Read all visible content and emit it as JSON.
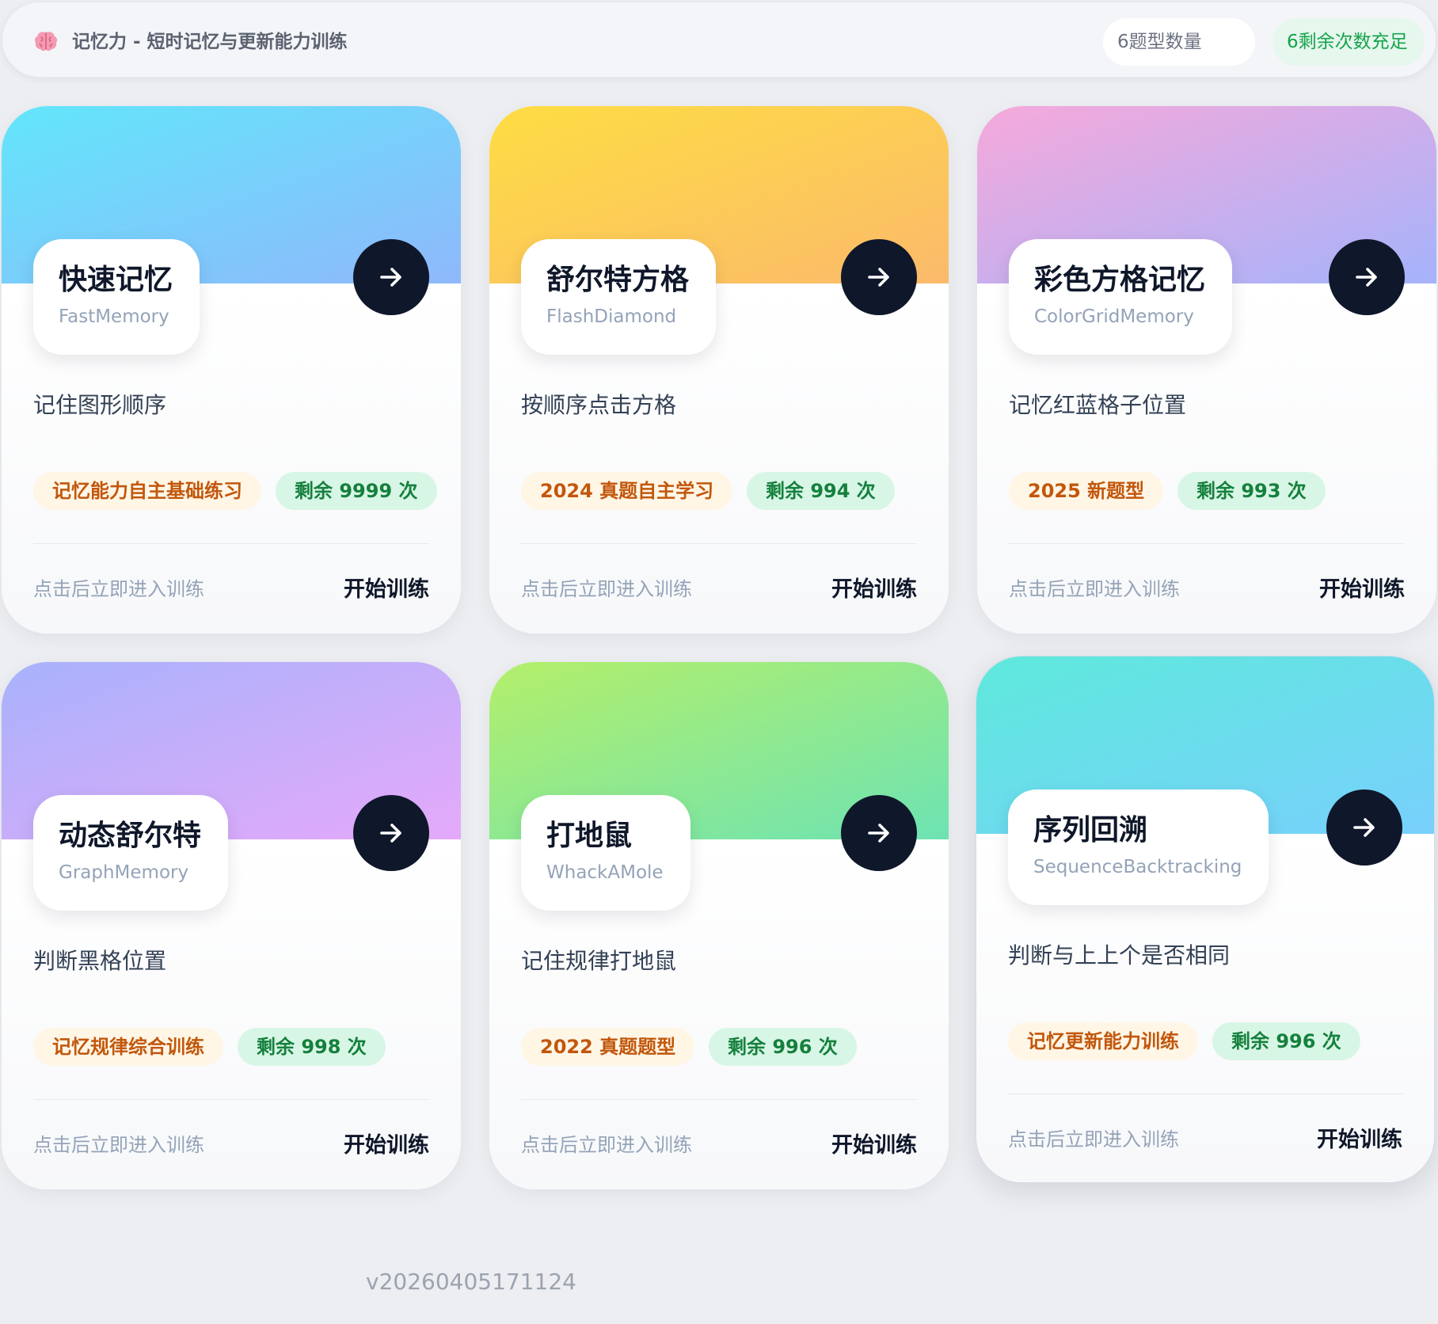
{
  "header": {
    "logo_icon": "brain-icon",
    "title": "记忆力 - 短时记忆与更新能力训练",
    "count_pill": "6题型数量",
    "remaining_pill": "6剩余次数充足"
  },
  "cards": [
    {
      "name": "快速记忆",
      "en": "FastMemory",
      "desc": "记住图形顺序",
      "tag": "记忆能力自主基础练习",
      "remaining": "剩余 9999 次",
      "hint": "点击后立即进入训练",
      "start": "开始训练",
      "gradient": [
        "#62e6fb",
        "#8fb8fb"
      ]
    },
    {
      "name": "舒尔特方格",
      "en": "FlashDiamond",
      "desc": "按顺序点击方格",
      "tag": "2024 真题自主学习",
      "remaining": "剩余 994 次",
      "hint": "点击后立即进入训练",
      "start": "开始训练",
      "gradient": [
        "#fedd43",
        "#fbba6b"
      ]
    },
    {
      "name": "彩色方格记忆",
      "en": "ColorGridMemory",
      "desc": "记忆红蓝格子位置",
      "tag": "2025 新题型",
      "remaining": "剩余 993 次",
      "hint": "点击后立即进入训练",
      "start": "开始训练",
      "gradient": [
        "#f6a9db",
        "#a5b3fb"
      ]
    },
    {
      "name": "动态舒尔特",
      "en": "GraphMemory",
      "desc": "判断黑格位置",
      "tag": "记忆规律综合训练",
      "remaining": "剩余 998 次",
      "hint": "点击后立即进入训练",
      "start": "开始训练",
      "gradient": [
        "#a8b2fb",
        "#e5a9fa"
      ]
    },
    {
      "name": "打地鼠",
      "en": "WhackAMole",
      "desc": "记住规律打地鼠",
      "tag": "2022 真题题型",
      "remaining": "剩余 996 次",
      "hint": "点击后立即进入训练",
      "start": "开始训练",
      "gradient": [
        "#b4ef6a",
        "#6de3b3"
      ]
    },
    {
      "name": "序列回溯",
      "en": "SequenceBacktracking",
      "desc": "判断与上上个是否相同",
      "tag": "记忆更新能力训练",
      "remaining": "剩余 996 次",
      "hint": "点击后立即进入训练",
      "start": "开始训练",
      "gradient": [
        "#5ee9dc",
        "#78d0fc"
      ]
    }
  ],
  "version": "v20260405171124",
  "colors": {
    "page_bg": "#eceef2",
    "arrow_bg": "#0f172a",
    "tag_orange_text": "#c2570c",
    "tag_green_text": "#15803d"
  }
}
